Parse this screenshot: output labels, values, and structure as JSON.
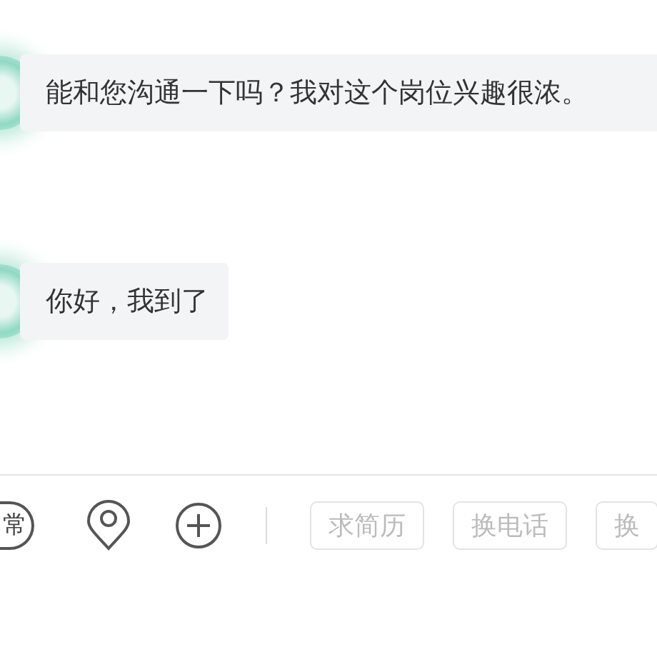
{
  "messages": [
    {
      "text": "能和您沟通一下吗？我对这个岗位兴趣很浓。"
    },
    {
      "text": "你好，我到了"
    }
  ],
  "toolbar": {
    "tools": [
      {
        "kind": "glyph",
        "glyph": "常"
      },
      {
        "kind": "location"
      },
      {
        "kind": "plus"
      }
    ],
    "quick_replies": [
      {
        "label": "求简历",
        "disabled": true
      },
      {
        "label": "换电话",
        "disabled": true
      },
      {
        "label": "换",
        "disabled": true
      }
    ]
  }
}
